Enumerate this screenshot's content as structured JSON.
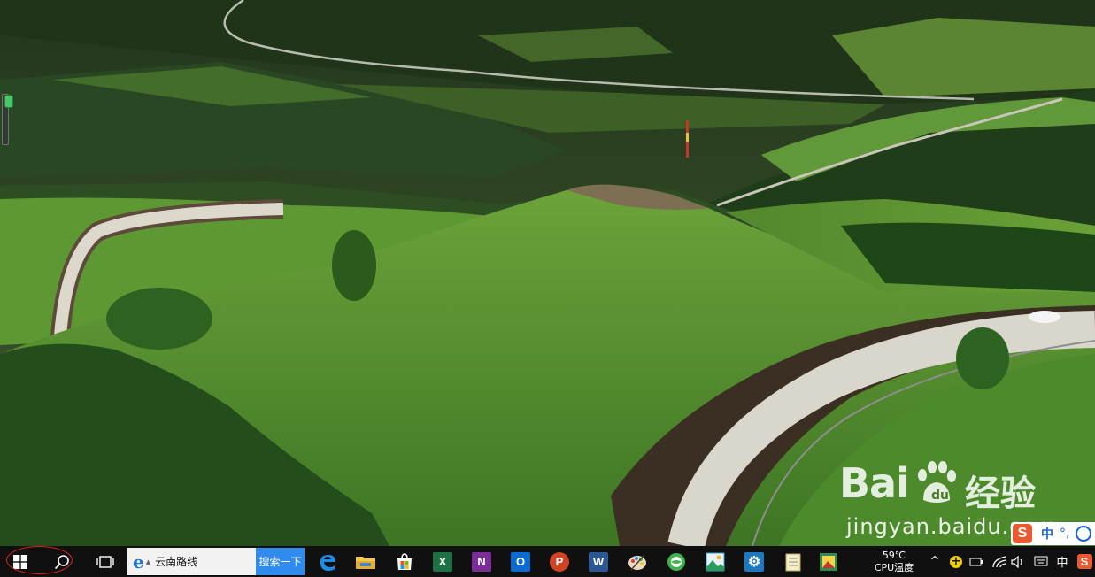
{
  "watermark": {
    "logo": "Bai",
    "cn": "经验",
    "url": "jingyan.baidu.com"
  },
  "ime_bar": {
    "logo_letter": "S",
    "lang": "中",
    "punct": "°,"
  },
  "taskbar": {
    "search_box_text": "云南路线",
    "search_button": "搜索一下",
    "apps": [
      "edge",
      "file-explorer",
      "store",
      "excel",
      "onenote",
      "outlook",
      "powerpoint",
      "word",
      "paint",
      "360-browser",
      "photos",
      "settings",
      "notepad",
      "photo-viewer"
    ],
    "cpu_temp": "59℃",
    "cpu_label": "CPU温度",
    "ime_lang": "中",
    "tray_logo": "S"
  },
  "colors": {
    "taskbar_bg": "#101010",
    "search_button_bg": "#2f8bee",
    "highlight_ellipse": "#e02020",
    "sogou_red": "#ea5a2e"
  }
}
